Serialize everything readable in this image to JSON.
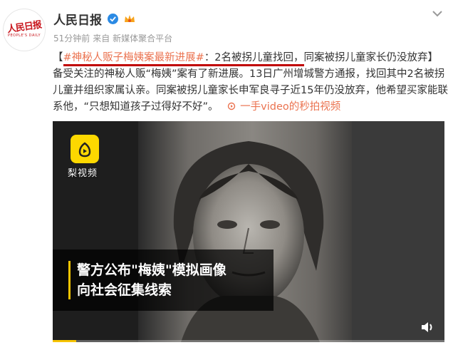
{
  "account": {
    "avatar_logo_text": "人民日报",
    "avatar_logo_en": "PEOPLE'S DAILY",
    "name": "人民日报"
  },
  "meta": {
    "time": "51分钟前",
    "source": "来自 新媒体聚合平台"
  },
  "post": {
    "open_bracket": "【",
    "hashtag": "#神秘人贩子梅姨案最新进展#",
    "headline": "：2名被拐儿童找回，",
    "headline_rest": "同案被拐儿童家长仍没放弃】",
    "body": "备受关注的神秘人贩“梅姨”案有了新进展。13日广州增城警方通报，找回其中2名被拐儿童并组织家属认亲。同案被拐儿童家长申军良寻子近15年仍没放弃，他希望买家能联系他，“只想知道孩子过得好不好”。",
    "video_link": "一手video的秒拍视频"
  },
  "video": {
    "brand_label": "梨视频",
    "caption_line1": "警方公布\"梅姨\"模拟画像",
    "caption_line2": "向社会征集线索",
    "progress": 0.06
  },
  "colors": {
    "link": "#eb7350",
    "verified": "#2b8ae4",
    "brand_yellow": "#fdd800",
    "underline": "#c00000"
  },
  "icons": [
    "verified-icon",
    "vip-crown-icon",
    "more-chevron-icon",
    "video-link-icon",
    "pear-logo-icon",
    "volume-icon"
  ]
}
